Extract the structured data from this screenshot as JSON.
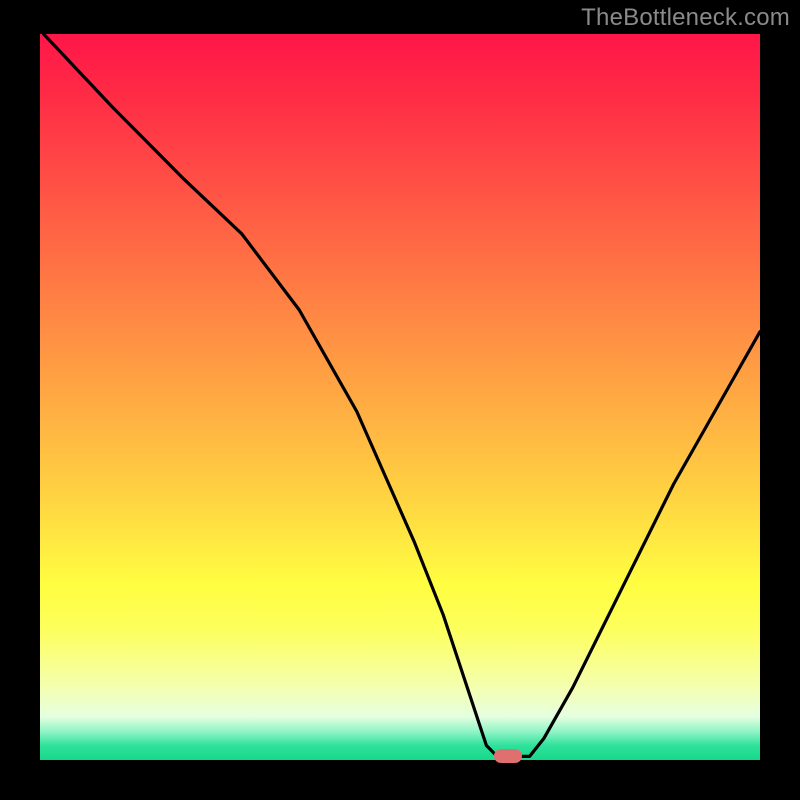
{
  "watermark": "TheBottleneck.com",
  "colors": {
    "background": "#000000",
    "curve": "#000000",
    "marker": "#e07070"
  },
  "chart_data": {
    "type": "line",
    "title": "",
    "xlabel": "",
    "ylabel": "",
    "xlim": [
      0,
      100
    ],
    "ylim": [
      0,
      100
    ],
    "gradient_meaning": "heatmap background from red (top, high bottleneck) to green (bottom, no bottleneck)",
    "series": [
      {
        "name": "bottleneck-curve",
        "x": [
          0.5,
          10,
          20,
          28,
          36,
          44,
          52,
          56,
          60,
          62,
          63.5,
          65,
          68,
          70,
          74,
          80,
          88,
          96,
          100
        ],
        "values": [
          100,
          90,
          80,
          72.5,
          62,
          48,
          30,
          20,
          8,
          2,
          0.5,
          0.5,
          0.5,
          3,
          10,
          22,
          38,
          52,
          59
        ]
      }
    ],
    "marker": {
      "name": "optimal-point",
      "x_range": [
        63,
        67
      ],
      "y": 0.5
    }
  }
}
